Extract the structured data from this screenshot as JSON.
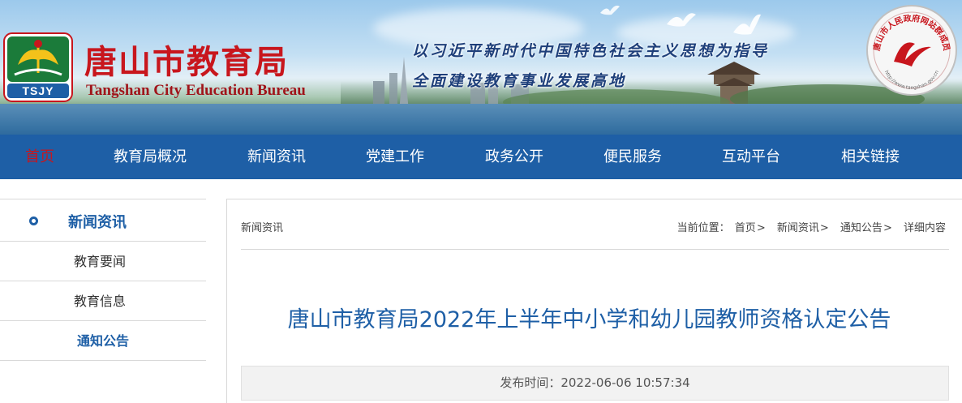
{
  "header": {
    "title_cn": "唐山市教育局",
    "title_en": "Tangshan City Education Bureau",
    "logo_text": "TSJY",
    "slogan_line1": "以习近平新时代中国特色社会主义思想为指导",
    "slogan_line2": "全面建设教育事业发展高地",
    "seal_text": "唐山市人民政府网站群成员",
    "seal_url": "http://www.tangshan.gov.cn"
  },
  "nav": {
    "items": [
      {
        "label": "首页"
      },
      {
        "label": "教育局概况"
      },
      {
        "label": "新闻资讯"
      },
      {
        "label": "党建工作"
      },
      {
        "label": "政务公开"
      },
      {
        "label": "便民服务"
      },
      {
        "label": "互动平台"
      },
      {
        "label": "相关链接"
      }
    ],
    "active_index": 0
  },
  "sidebar": {
    "heading": "新闻资讯",
    "items": [
      {
        "label": "教育要闻"
      },
      {
        "label": "教育信息"
      },
      {
        "label": "通知公告"
      }
    ],
    "active_index": 2
  },
  "main": {
    "section_name": "新闻资讯",
    "breadcrumb": {
      "prefix": "当前位置：",
      "items": [
        "首页",
        "新闻资讯",
        "通知公告",
        "详细内容"
      ],
      "separator": ">"
    },
    "article_title": "唐山市教育局2022年上半年中小学和幼儿园教师资格认定公告",
    "publish_label": "发布时间：",
    "publish_time": "2022-06-06 10:57:34"
  },
  "colors": {
    "nav_bg": "#1e5fa6",
    "accent_blue": "#1e5fa6",
    "brand_red": "#c8161d"
  }
}
